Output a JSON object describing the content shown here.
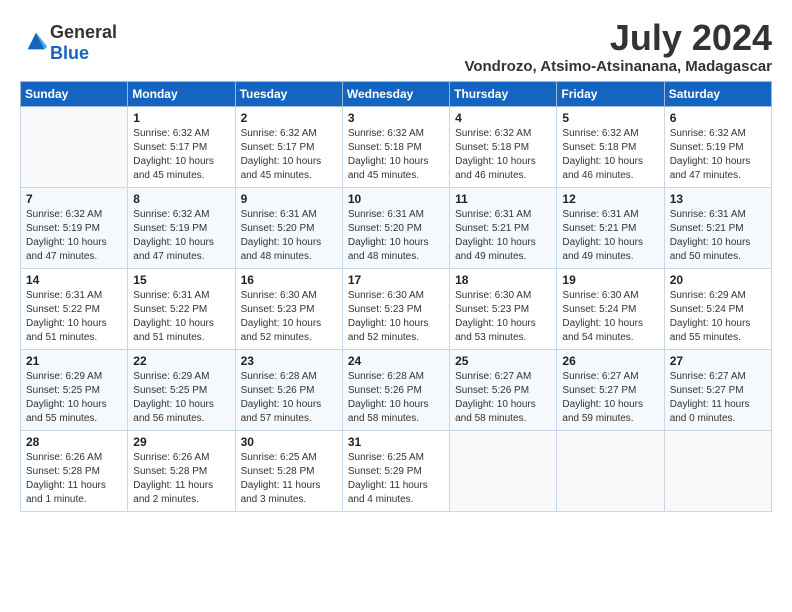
{
  "header": {
    "logo_general": "General",
    "logo_blue": "Blue",
    "month_title": "July 2024",
    "location": "Vondrozo, Atsimo-Atsinanana, Madagascar"
  },
  "weekdays": [
    "Sunday",
    "Monday",
    "Tuesday",
    "Wednesday",
    "Thursday",
    "Friday",
    "Saturday"
  ],
  "weeks": [
    [
      {
        "day": "",
        "info": ""
      },
      {
        "day": "1",
        "info": "Sunrise: 6:32 AM\nSunset: 5:17 PM\nDaylight: 10 hours\nand 45 minutes."
      },
      {
        "day": "2",
        "info": "Sunrise: 6:32 AM\nSunset: 5:17 PM\nDaylight: 10 hours\nand 45 minutes."
      },
      {
        "day": "3",
        "info": "Sunrise: 6:32 AM\nSunset: 5:18 PM\nDaylight: 10 hours\nand 45 minutes."
      },
      {
        "day": "4",
        "info": "Sunrise: 6:32 AM\nSunset: 5:18 PM\nDaylight: 10 hours\nand 46 minutes."
      },
      {
        "day": "5",
        "info": "Sunrise: 6:32 AM\nSunset: 5:18 PM\nDaylight: 10 hours\nand 46 minutes."
      },
      {
        "day": "6",
        "info": "Sunrise: 6:32 AM\nSunset: 5:19 PM\nDaylight: 10 hours\nand 47 minutes."
      }
    ],
    [
      {
        "day": "7",
        "info": "Sunrise: 6:32 AM\nSunset: 5:19 PM\nDaylight: 10 hours\nand 47 minutes."
      },
      {
        "day": "8",
        "info": "Sunrise: 6:32 AM\nSunset: 5:19 PM\nDaylight: 10 hours\nand 47 minutes."
      },
      {
        "day": "9",
        "info": "Sunrise: 6:31 AM\nSunset: 5:20 PM\nDaylight: 10 hours\nand 48 minutes."
      },
      {
        "day": "10",
        "info": "Sunrise: 6:31 AM\nSunset: 5:20 PM\nDaylight: 10 hours\nand 48 minutes."
      },
      {
        "day": "11",
        "info": "Sunrise: 6:31 AM\nSunset: 5:21 PM\nDaylight: 10 hours\nand 49 minutes."
      },
      {
        "day": "12",
        "info": "Sunrise: 6:31 AM\nSunset: 5:21 PM\nDaylight: 10 hours\nand 49 minutes."
      },
      {
        "day": "13",
        "info": "Sunrise: 6:31 AM\nSunset: 5:21 PM\nDaylight: 10 hours\nand 50 minutes."
      }
    ],
    [
      {
        "day": "14",
        "info": "Sunrise: 6:31 AM\nSunset: 5:22 PM\nDaylight: 10 hours\nand 51 minutes."
      },
      {
        "day": "15",
        "info": "Sunrise: 6:31 AM\nSunset: 5:22 PM\nDaylight: 10 hours\nand 51 minutes."
      },
      {
        "day": "16",
        "info": "Sunrise: 6:30 AM\nSunset: 5:23 PM\nDaylight: 10 hours\nand 52 minutes."
      },
      {
        "day": "17",
        "info": "Sunrise: 6:30 AM\nSunset: 5:23 PM\nDaylight: 10 hours\nand 52 minutes."
      },
      {
        "day": "18",
        "info": "Sunrise: 6:30 AM\nSunset: 5:23 PM\nDaylight: 10 hours\nand 53 minutes."
      },
      {
        "day": "19",
        "info": "Sunrise: 6:30 AM\nSunset: 5:24 PM\nDaylight: 10 hours\nand 54 minutes."
      },
      {
        "day": "20",
        "info": "Sunrise: 6:29 AM\nSunset: 5:24 PM\nDaylight: 10 hours\nand 55 minutes."
      }
    ],
    [
      {
        "day": "21",
        "info": "Sunrise: 6:29 AM\nSunset: 5:25 PM\nDaylight: 10 hours\nand 55 minutes."
      },
      {
        "day": "22",
        "info": "Sunrise: 6:29 AM\nSunset: 5:25 PM\nDaylight: 10 hours\nand 56 minutes."
      },
      {
        "day": "23",
        "info": "Sunrise: 6:28 AM\nSunset: 5:26 PM\nDaylight: 10 hours\nand 57 minutes."
      },
      {
        "day": "24",
        "info": "Sunrise: 6:28 AM\nSunset: 5:26 PM\nDaylight: 10 hours\nand 58 minutes."
      },
      {
        "day": "25",
        "info": "Sunrise: 6:27 AM\nSunset: 5:26 PM\nDaylight: 10 hours\nand 58 minutes."
      },
      {
        "day": "26",
        "info": "Sunrise: 6:27 AM\nSunset: 5:27 PM\nDaylight: 10 hours\nand 59 minutes."
      },
      {
        "day": "27",
        "info": "Sunrise: 6:27 AM\nSunset: 5:27 PM\nDaylight: 11 hours\nand 0 minutes."
      }
    ],
    [
      {
        "day": "28",
        "info": "Sunrise: 6:26 AM\nSunset: 5:28 PM\nDaylight: 11 hours\nand 1 minute."
      },
      {
        "day": "29",
        "info": "Sunrise: 6:26 AM\nSunset: 5:28 PM\nDaylight: 11 hours\nand 2 minutes."
      },
      {
        "day": "30",
        "info": "Sunrise: 6:25 AM\nSunset: 5:28 PM\nDaylight: 11 hours\nand 3 minutes."
      },
      {
        "day": "31",
        "info": "Sunrise: 6:25 AM\nSunset: 5:29 PM\nDaylight: 11 hours\nand 4 minutes."
      },
      {
        "day": "",
        "info": ""
      },
      {
        "day": "",
        "info": ""
      },
      {
        "day": "",
        "info": ""
      }
    ]
  ]
}
